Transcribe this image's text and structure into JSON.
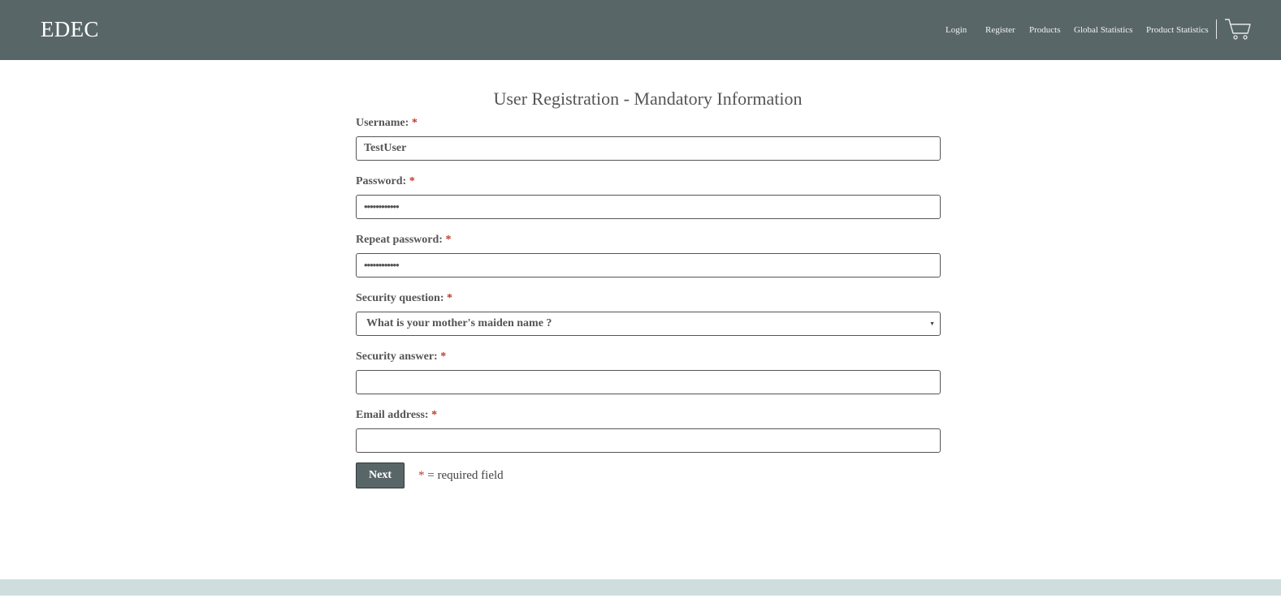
{
  "header": {
    "brand": "EDEC",
    "nav": [
      "Login",
      "Register",
      "Products",
      "Global Statistics",
      "Product Statistics"
    ],
    "cart_icon": "shopping-cart-icon",
    "background_color": "#596668"
  },
  "page": {
    "title": "User Registration - Mandatory Information"
  },
  "form": {
    "required_marker": "*",
    "fields": {
      "username": {
        "label": "Username:",
        "value": "TestUser"
      },
      "password": {
        "label": "Password:",
        "value": "••••••••••••"
      },
      "repeat_password": {
        "label": "Repeat password:",
        "value": "••••••••••••"
      },
      "security_question": {
        "label": "Security question:",
        "value": "What is your mother's maiden name ?"
      },
      "security_answer": {
        "label": "Security answer:",
        "value": ""
      },
      "email": {
        "label": "Email address:",
        "value": ""
      }
    },
    "next_label": "Next",
    "required_note": "= required field"
  },
  "colors": {
    "accent": "#596668",
    "required": "#c0392b",
    "footer": "#cfdddd"
  }
}
